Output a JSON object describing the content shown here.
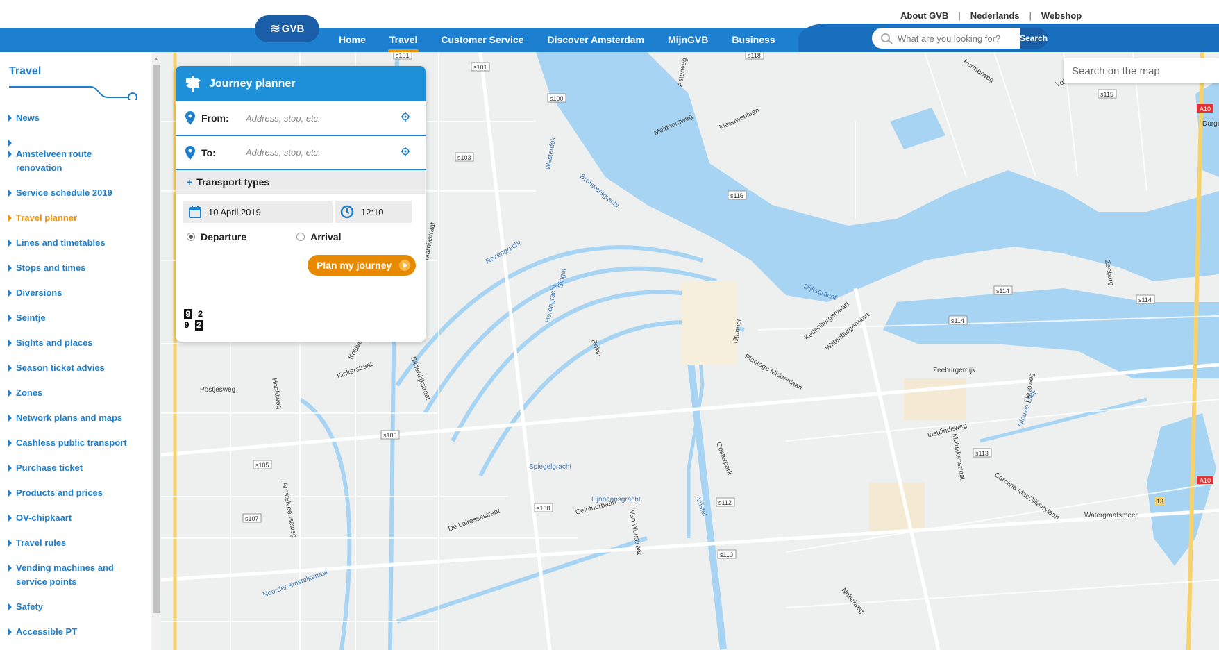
{
  "util_links": [
    "About GVB",
    "Nederlands",
    "Webshop"
  ],
  "logo": "GVB",
  "nav": {
    "items": [
      "Home",
      "Travel",
      "Customer Service",
      "Discover Amsterdam",
      "MijnGVB",
      "Business"
    ],
    "active": "Travel"
  },
  "search": {
    "placeholder": "What are you looking for?",
    "button": "Search"
  },
  "sidebar": {
    "title": "Travel",
    "items": [
      "News",
      "",
      "Amstelveen route renovation",
      "Service schedule 2019",
      "Travel planner",
      "Lines and timetables",
      "Stops and times",
      "Diversions",
      "Seintje",
      "Sights and places",
      "Season ticket advies",
      "Zones",
      "Network plans and maps",
      "Cashless public transport",
      "Purchase ticket",
      "Products and prices",
      "OV-chipkaart",
      "Travel rules",
      "Vending machines and service points",
      "Safety",
      "Accessible PT"
    ],
    "active": "Travel planner"
  },
  "journey_planner": {
    "title": "Journey planner",
    "from_label": "From:",
    "to_label": "To:",
    "from_placeholder": "Address, stop, etc.",
    "to_placeholder": "Address, stop, etc.",
    "transport_types": "Transport types",
    "date": "10 April 2019",
    "time": "12:10",
    "departure": "Departure",
    "arrival": "Arrival",
    "selected": "Departure",
    "plan_button": "Plan my journey",
    "badge": [
      "9",
      "2",
      "9",
      "2"
    ]
  },
  "map": {
    "search_placeholder": "Search on the map",
    "water_color": "#a8d4f3",
    "land_color": "#eef0f0",
    "road_labels": [
      "s101",
      "s100",
      "s118",
      "s115",
      "s103",
      "s116",
      "s114",
      "s106",
      "s112",
      "s113",
      "s108",
      "s107",
      "s110",
      "s105",
      "A10",
      "13"
    ],
    "street_labels": [
      "Westerdok",
      "Brouwersgracht",
      "Rozengracht",
      "Singel",
      "Herengracht",
      "Kinkerstraat",
      "Postjesweg",
      "Spiegelgracht",
      "Lijnbaansgracht",
      "Ceintuurbaan",
      "Amstel",
      "Dijksgracht",
      "Zeeburgerdijk",
      "Insulindeweg",
      "Nieuwe Diep",
      "Meeuwenlaan",
      "Oosterpark",
      "Plantage Middenlaan",
      "Watergraafsmeer",
      "De Lairessestraat",
      "Noorder Amstelkanaal",
      "Van Woustraat",
      "Carolina MacGillavrylaan",
      "Molukkenstraat",
      "Flevoweg",
      "Zeeburg",
      "Rokin",
      "Marnixstraat",
      "Bilderdijkstraat",
      "Kostverlorenvaart",
      "Hoofdweg",
      "Amstelveenseweg",
      "IJtunnel",
      "Kattenburgervaart",
      "Wittenburgervaart",
      "Nobelweg",
      "Meidoornweg",
      "Asterweg",
      "Purmerweg",
      "Volendammerweg",
      "Durgerdam"
    ]
  }
}
